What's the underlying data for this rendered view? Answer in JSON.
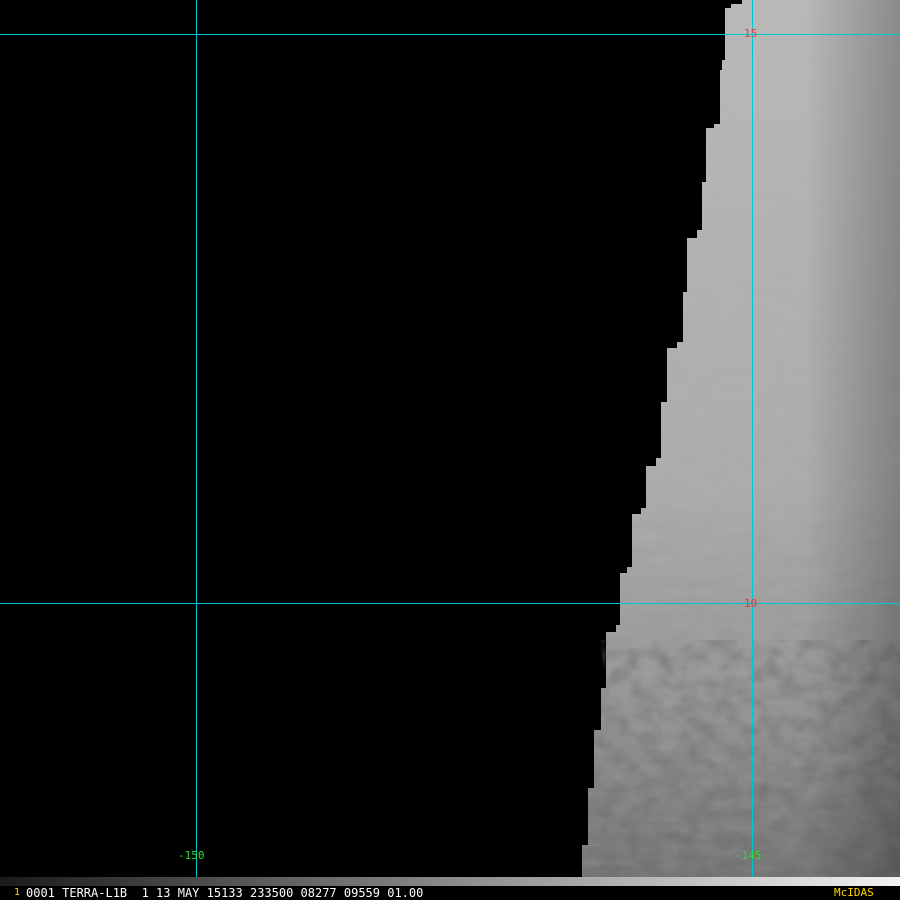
{
  "image": {
    "latitude_labels": [
      "15",
      "10"
    ],
    "longitude_labels": [
      "-150",
      "-145"
    ]
  },
  "colors": {
    "gridline": "#00c8d0",
    "latitude_label": "#ff3030",
    "longitude_label": "#33dd33",
    "status_text": "#ffffff",
    "accent_text": "#ffd700",
    "background": "#000000"
  },
  "statusbar": {
    "frame_number": "1",
    "info": "0001 TERRA-L1B  1 13 MAY 15133 233500 08277 09559 01.00",
    "brand": "McIDAS"
  }
}
